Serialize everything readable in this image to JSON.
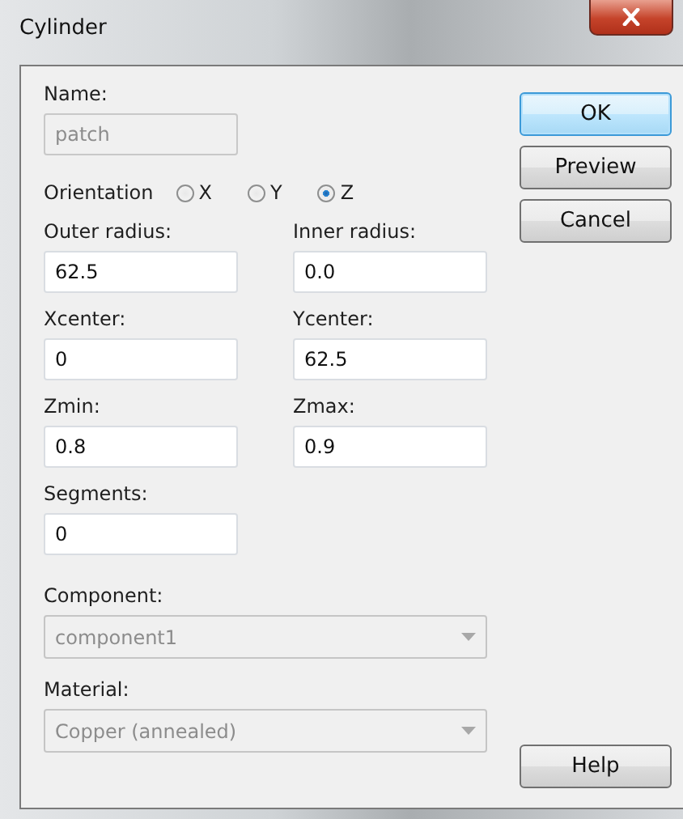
{
  "window": {
    "title": "Cylinder"
  },
  "name": {
    "label": "Name:",
    "value": "patch",
    "disabled": true
  },
  "orientation": {
    "label": "Orientation",
    "options": [
      {
        "label": "X",
        "selected": false
      },
      {
        "label": "Y",
        "selected": false
      },
      {
        "label": "Z",
        "selected": true
      }
    ]
  },
  "fields": [
    {
      "label": "Outer radius:",
      "value": "62.5"
    },
    {
      "label": "Inner radius:",
      "value": "0.0"
    },
    {
      "label": "Xcenter:",
      "value": "0"
    },
    {
      "label": "Ycenter:",
      "value": "62.5"
    },
    {
      "label": "Zmin:",
      "value": "0.8"
    },
    {
      "label": "Zmax:",
      "value": "0.9"
    },
    {
      "label": "Segments:",
      "value": "0"
    }
  ],
  "dropdowns": [
    {
      "label": "Component:",
      "value": "component1",
      "disabled": true
    },
    {
      "label": "Material:",
      "value": "Copper (annealed)",
      "disabled": true
    }
  ],
  "buttons": [
    {
      "label": "OK",
      "default": true
    },
    {
      "label": "Preview",
      "default": false
    },
    {
      "label": "Cancel",
      "default": false
    }
  ],
  "help_button": {
    "label": "Help"
  }
}
